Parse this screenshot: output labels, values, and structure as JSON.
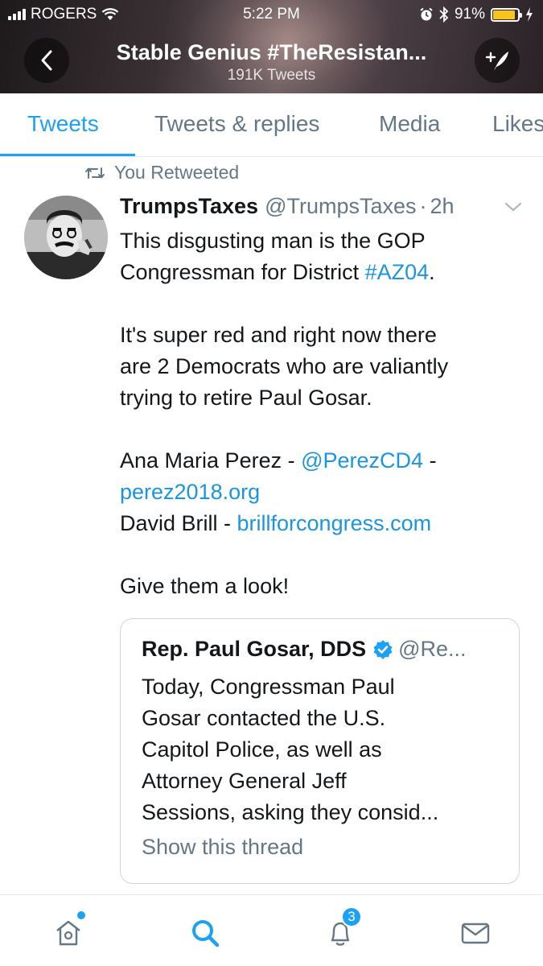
{
  "status_bar": {
    "carrier": "ROGERS",
    "time": "5:22 PM",
    "battery_percent": "91%",
    "battery_level": 0.91,
    "battery_color": "#f7c41f"
  },
  "header": {
    "title": "Stable Genius #TheResistan...",
    "subtitle": "191K Tweets"
  },
  "tabs": [
    {
      "label": "Tweets",
      "active": true
    },
    {
      "label": "Tweets & replies",
      "active": false
    },
    {
      "label": "Media",
      "active": false
    },
    {
      "label": "Likes",
      "active": false
    }
  ],
  "tweet": {
    "retweet_label": "You Retweeted",
    "author_name": "TrumpsTaxes",
    "author_handle": "@TrumpsTaxes",
    "separator": "·",
    "timestamp": "2h",
    "lines": {
      "l1": "This disgusting man is the GOP",
      "l2": "Congressman for District ",
      "hashtag": "#AZ04",
      "l2_end": ".",
      "p2_l1": "It's super red and right now there",
      "p2_l2": "are 2 Democrats who are valiantly",
      "p2_l3": "trying to retire Paul Gosar.",
      "c1_name": "Ana Maria Perez - ",
      "c1_handle": "@PerezCD4",
      "c1_dash": " -",
      "c1_site": "perez2018.org",
      "c2_name": "David Brill - ",
      "c2_site": "brillforcongress.com",
      "closing": "Give them a look!"
    }
  },
  "quote": {
    "name": "Rep. Paul Gosar, DDS",
    "handle": "@Re...",
    "text_lines": [
      "Today, Congressman Paul",
      "Gosar contacted the U.S.",
      "Capitol Police, as well as",
      "Attorney General Jeff",
      "Sessions, asking they consid..."
    ],
    "show_thread": "Show this thread"
  },
  "bottom_nav": {
    "notifications_count": "3"
  },
  "colors": {
    "accent": "#1da1f2",
    "link": "#1b95e0",
    "muted": "#657786"
  }
}
